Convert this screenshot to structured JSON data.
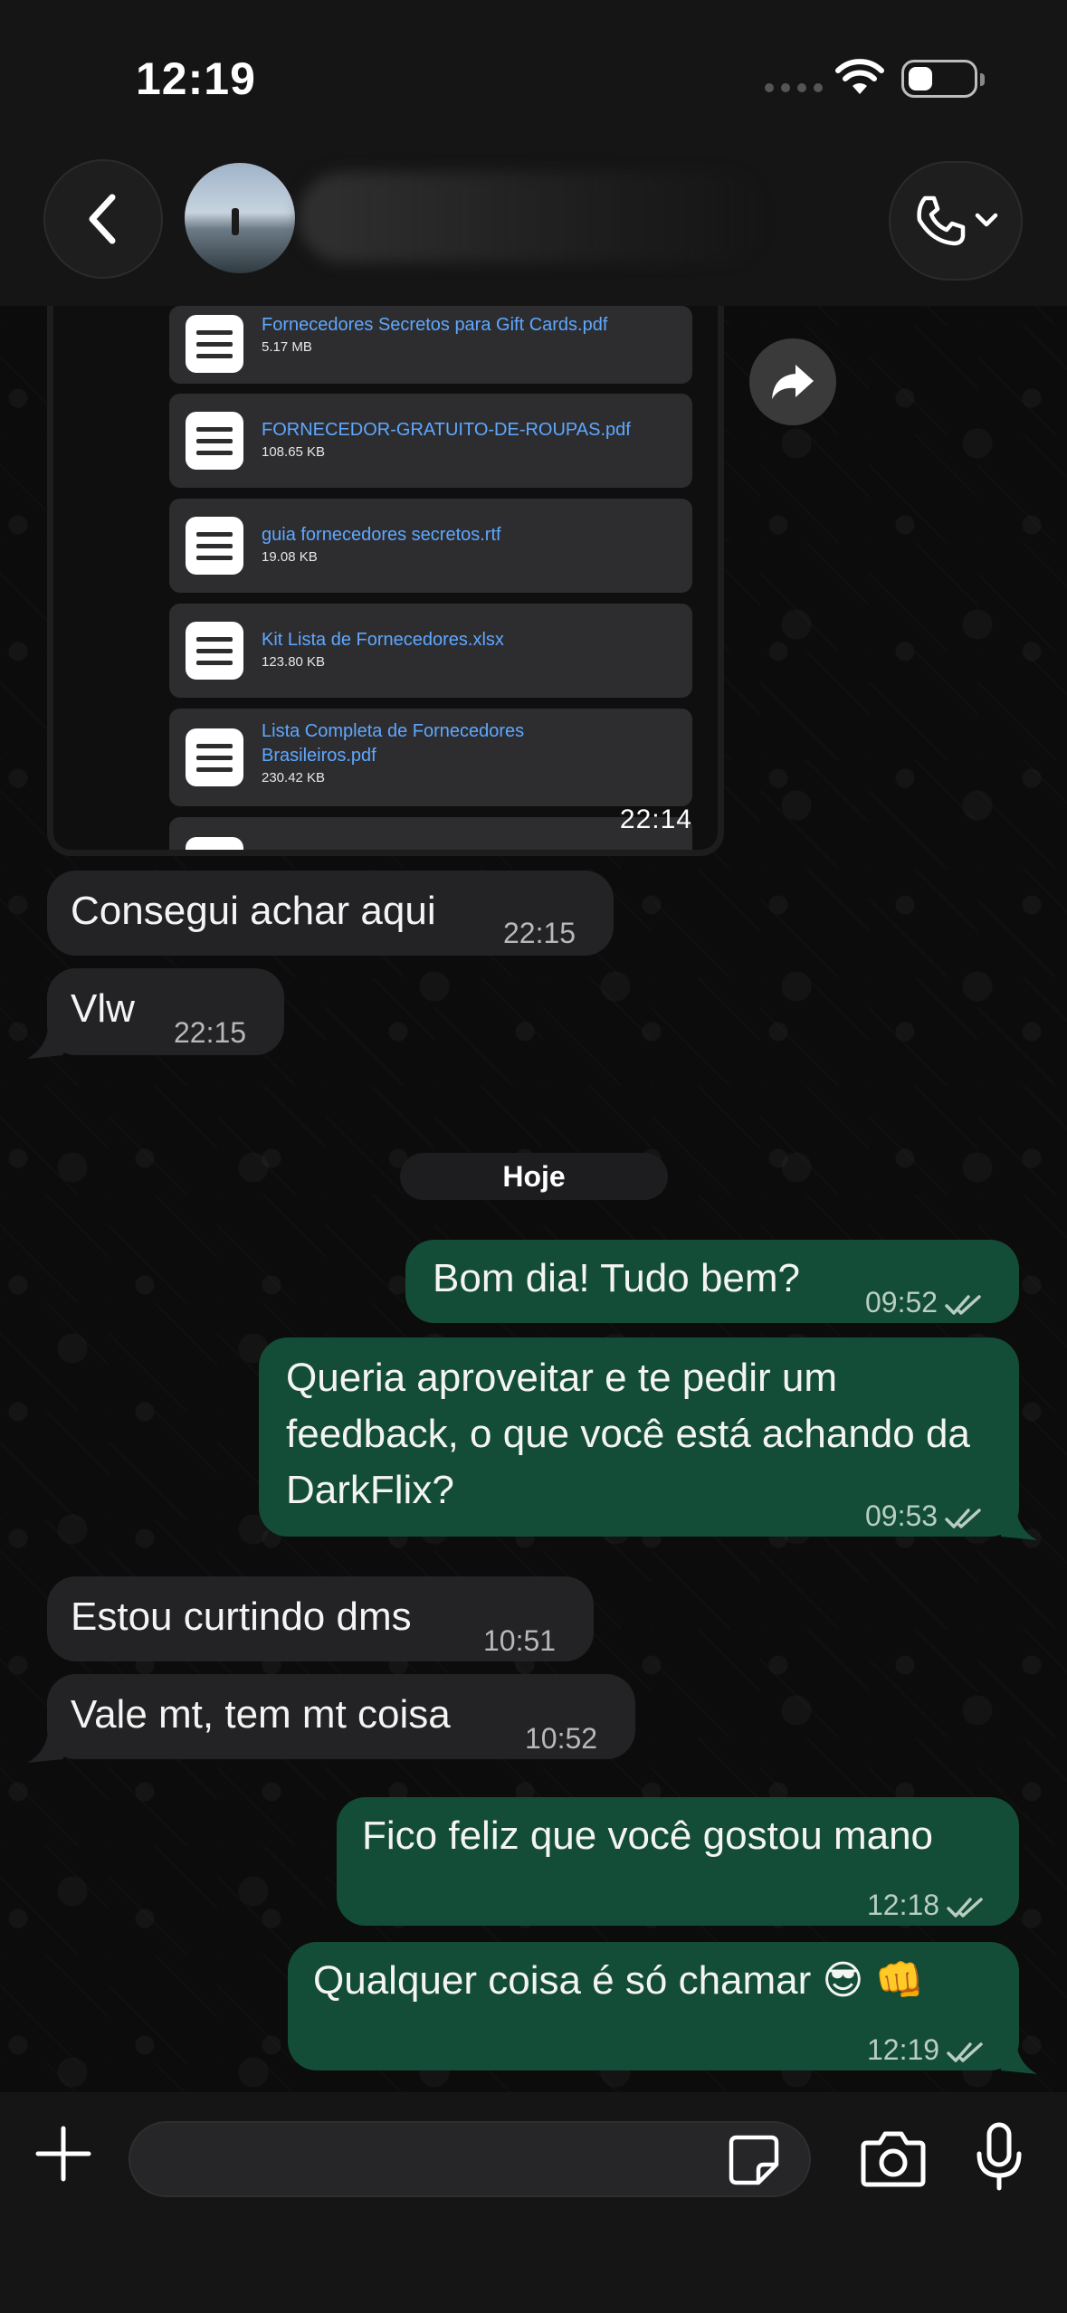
{
  "status_bar": {
    "time": "12:19"
  },
  "header": {
    "contact_name": ""
  },
  "documents_message": {
    "files": [
      {
        "name": "Fornecedores Secretos para Gift Cards.pdf",
        "size": "5.17 MB"
      },
      {
        "name": "FORNECEDOR-GRATUITO-DE-ROUPAS.pdf",
        "size": "108.65 KB"
      },
      {
        "name": "guia fornecedores secretos.rtf",
        "size": "19.08 KB"
      },
      {
        "name": "Kit Lista de Fornecedores.xlsx",
        "size": "123.80 KB"
      },
      {
        "name": "Lista Completa de Fornecedores Brasileiros.pdf",
        "size": "230.42 KB"
      }
    ],
    "time": "22:14"
  },
  "messages": [
    {
      "direction": "in",
      "text": "Consegui achar aqui",
      "time": "22:15"
    },
    {
      "direction": "in",
      "text": "Vlw",
      "time": "22:15"
    },
    {
      "direction": "out",
      "text": "Bom dia! Tudo bem?",
      "time": "09:52",
      "status": "read"
    },
    {
      "direction": "out",
      "text": "Queria aproveitar e te pedir um feedback, o que você está achando da DarkFlix?",
      "time": "09:53",
      "status": "read"
    },
    {
      "direction": "in",
      "text": "Estou curtindo dms",
      "time": "10:51"
    },
    {
      "direction": "in",
      "text": "Vale mt, tem mt coisa",
      "time": "10:52"
    },
    {
      "direction": "out",
      "text": "Fico feliz que você gostou mano",
      "time": "12:18",
      "status": "read"
    },
    {
      "direction": "out",
      "text": "Qualquer coisa é só chamar 😎 👊",
      "time": "12:19",
      "status": "read"
    }
  ],
  "date_separator": "Hoje",
  "composer": {
    "placeholder": ""
  },
  "icons": {
    "back": "chevron-left-icon",
    "call": "phone-icon",
    "forward": "forward-icon",
    "plus": "plus-icon",
    "sticker": "sticker-icon",
    "camera": "camera-icon",
    "mic": "microphone-icon",
    "read_receipt": "double-check-icon",
    "document": "document-icon"
  },
  "colors": {
    "outgoing_bubble": "#134d37",
    "incoming_bubble": "#232325",
    "link_blue": "#5ea8ff",
    "background": "#0c0c0c"
  }
}
